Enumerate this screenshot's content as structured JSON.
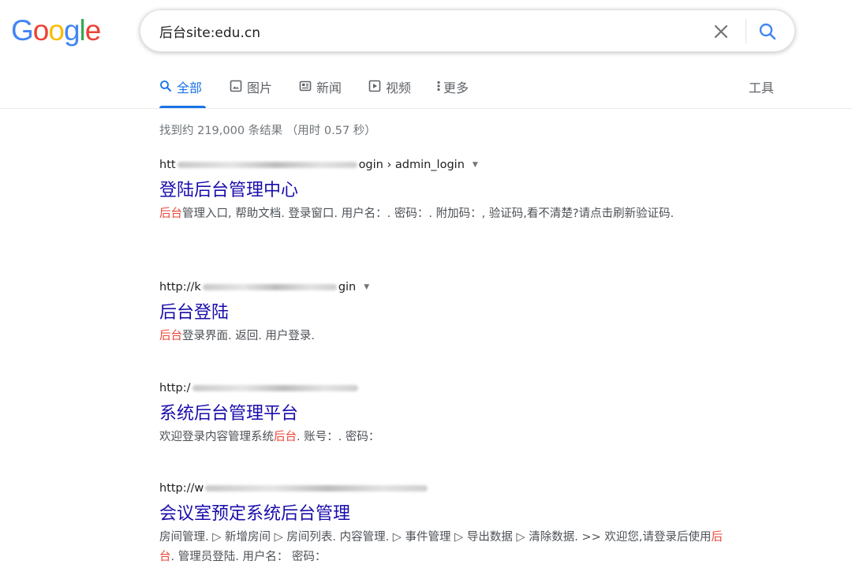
{
  "logo": {
    "letters": [
      "G",
      "o",
      "o",
      "g",
      "l",
      "e"
    ]
  },
  "search": {
    "query": "后台site:edu.cn",
    "placeholder": ""
  },
  "tabs": [
    {
      "label": "全部",
      "icon": "search-icon"
    },
    {
      "label": "图片",
      "icon": "image-icon"
    },
    {
      "label": "新闻",
      "icon": "news-icon"
    },
    {
      "label": "视频",
      "icon": "video-icon"
    },
    {
      "label": "更多",
      "icon": "more-vert-icon"
    }
  ],
  "tools_label": "工具",
  "stats": "找到约 219,000 条结果 （用时 0.57 秒）",
  "results": [
    {
      "url_prefix": "htt",
      "url_suffix": "ogin › admin_login",
      "title": "登陆后台管理中心",
      "snippet_parts": [
        {
          "text": "后台",
          "hl": true
        },
        {
          "text": "管理入口, 帮助文档. 登录窗口. 用户名：. 密码：. 附加码：, 验证码,看不清楚?请点击刷新验证码.",
          "hl": false
        }
      ]
    },
    {
      "url_prefix": "http://k",
      "url_suffix": "gin",
      "title": "后台登陆",
      "snippet_parts": [
        {
          "text": "后台",
          "hl": true
        },
        {
          "text": "登录界面. 返回. 用户登录.",
          "hl": false
        }
      ]
    },
    {
      "url_prefix": "http:/",
      "url_suffix": "",
      "title": "系统后台管理平台",
      "snippet_parts": [
        {
          "text": "欢迎登录内容管理系统",
          "hl": false
        },
        {
          "text": "后台",
          "hl": true
        },
        {
          "text": ". 账号：. 密码：",
          "hl": false
        }
      ]
    },
    {
      "url_prefix": "http://w",
      "url_suffix": "",
      "title": "会议室预定系统后台管理",
      "snippet_parts": [
        {
          "text": "房间管理. ▷ 新增房间 ▷ 房间列表. 内容管理. ▷ 事件管理 ▷ 导出数据 ▷ 清除数据. >> 欢迎您,请登录后使用",
          "hl": false
        },
        {
          "text": "后台",
          "hl": true
        },
        {
          "text": ". 管理员登陆. 用户名：  密码：",
          "hl": false
        }
      ]
    }
  ],
  "colors": {
    "link": "#1a0dab",
    "accent": "#1a73e8",
    "highlight": "#ea4335"
  }
}
